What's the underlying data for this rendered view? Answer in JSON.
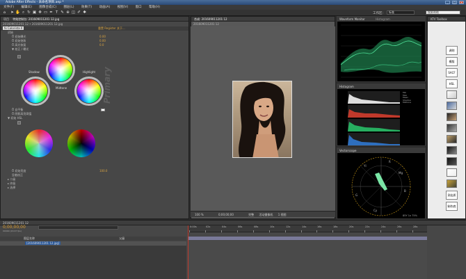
{
  "app": {
    "title": "Adobe After Effects - 未命名项目.aep *",
    "window_controls": [
      "_",
      "□",
      "×"
    ]
  },
  "menubar": [
    "文件(F)",
    "编辑(E)",
    "图像合成(C)",
    "图层(L)",
    "效果(T)",
    "动画(A)",
    "视图(V)",
    "窗口",
    "帮助(H)"
  ],
  "toolbar": {
    "tools": [
      "home-tool",
      "selection-tool",
      "hand-tool",
      "zoom-tool",
      "rotate-tool",
      "camera-tool",
      "pan-tool",
      "mask-tool",
      "pen-tool",
      "text-tool",
      "brush-tool",
      "clone-tool",
      "eraser-tool",
      "roto-tool",
      "puppet-tool"
    ],
    "workspace_label": "工作区:",
    "workspace_value": "标准",
    "search_placeholder": "搜索帮助"
  },
  "fx_panel": {
    "tabs": [
      "项目",
      "特效控制台: 201609011201 12.jpg"
    ],
    "crumb": "201609011201 12 • 201609011201 12.jpg",
    "header_left": "fx Colorista II",
    "header_right": "重置  Register  关于...",
    "rows": [
      {
        "label": "初始",
        "value": ""
      },
      {
        "label": "Ö 初始曝光",
        "value": "0.00"
      },
      {
        "label": "Ö 初始饱和",
        "value": "0.00"
      },
      {
        "label": "Ö 高光恢复",
        "value": "0.0"
      },
      {
        "label": "▼ 校正 / 曝光",
        "value": ""
      }
    ],
    "wheel_labels": {
      "shadow": "Shadow",
      "midtone": "Midtone",
      "highlight": "Highlight"
    },
    "primary_label": "Primary",
    "mid_rows": [
      {
        "label": "Ö 自平衡",
        "value": ""
      },
      {
        "label": "Ö 阴影高亮阈值",
        "value": ""
      },
      {
        "label": "▼ 初始 HSL",
        "value": ""
      }
    ],
    "bottom_rows": [
      {
        "label": "Ö 初始亮度",
        "value": "100.0"
      },
      {
        "label": "显着校正",
        "value": ""
      },
      {
        "label": "▸ 二级",
        "value": ""
      },
      {
        "label": "▸ 终极",
        "value": ""
      },
      {
        "label": "▸ 选择",
        "value": ""
      }
    ]
  },
  "comp_panel": {
    "tab": "合成: 201609011201 12",
    "crumb": "201609011201 12",
    "footer": [
      "100 %",
      "0;00;00;00",
      "完整",
      "活动摄像机",
      "1 视图"
    ]
  },
  "scopes": {
    "waveform_tab": "Waveform Monitor",
    "waveform_tab2": "Histogram",
    "histogram_tab": "Histogram",
    "vectorscope_tab": "Vectorscope",
    "histo_stats": [
      "Min",
      "Max",
      "Mean",
      "Shadow",
      "Midtone"
    ],
    "vector_labels": [
      "R",
      "Mg",
      "B",
      "Cy",
      "G",
      "Yl"
    ],
    "vector_readout": "85Y 1x 75%"
  },
  "toolbox": {
    "tab": "KTV Toolbox",
    "buttons": [
      "调则",
      "模版",
      "SACF",
      "HSL",
      "",
      "",
      "",
      "",
      "",
      "",
      "测出质",
      "制作底",
      "编辑图",
      "解雇包",
      "SIM"
    ]
  },
  "timeline": {
    "tab": "201609011201 12",
    "timecode": "0;00;00;00",
    "timecode_sub": "00000 (29.97 fps)",
    "columns": [
      "图层名称",
      "父级"
    ],
    "layer_name": "[201609011201 12.jpg]",
    "ruler_labels": [
      "0:00s",
      "02s",
      "04s",
      "06s",
      "08s",
      "10s",
      "12s",
      "14s",
      "16s",
      "18s",
      "20s",
      "22s",
      "24s",
      "26s",
      "28s"
    ]
  },
  "colors": {
    "accent_orange": "#e0a030",
    "panel_bg": "#474747",
    "comp_bg": "#585858",
    "scope_green": "#2ecc71"
  }
}
